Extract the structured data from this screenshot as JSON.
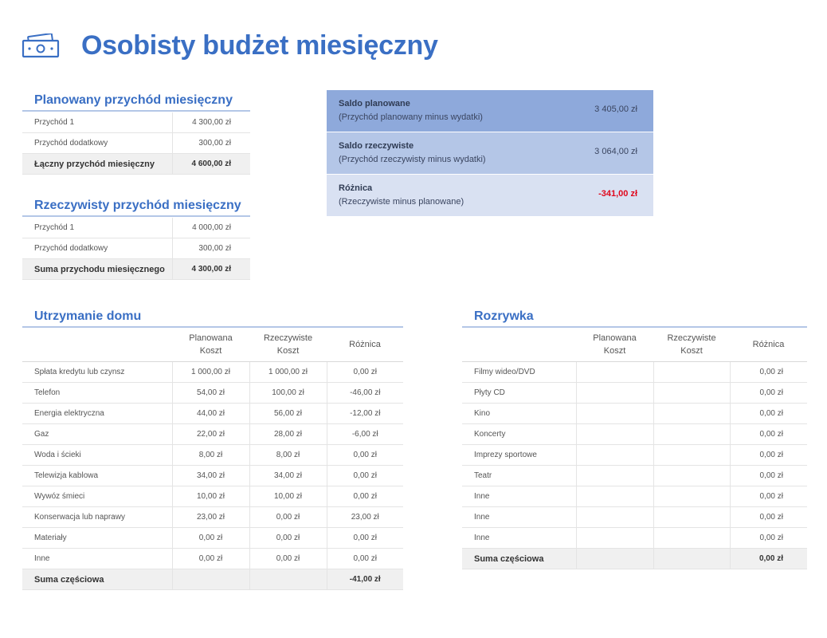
{
  "header": {
    "title": "Osobisty budżet miesięczny",
    "icon": "money-icon",
    "accent_color": "#3a6fc4"
  },
  "planned_income": {
    "title": "Planowany przychód miesięczny",
    "rows": [
      {
        "label": "Przychód 1",
        "value": "4 300,00 zł"
      },
      {
        "label": "Przychód dodatkowy",
        "value": "300,00 zł"
      }
    ],
    "total": {
      "label": "Łączny przychód miesięczny",
      "value": "4 600,00 zł"
    }
  },
  "actual_income": {
    "title": "Rzeczywisty przychód miesięczny",
    "rows": [
      {
        "label": "Przychód 1",
        "value": "4 000,00 zł"
      },
      {
        "label": "Przychód dodatkowy",
        "value": "300,00 zł"
      }
    ],
    "total": {
      "label": "Suma przychodu miesięcznego",
      "value": "4 300,00 zł"
    }
  },
  "saldo": {
    "rows": [
      {
        "title": "Saldo planowane",
        "subtitle": "(Przychód planowany minus wydatki)",
        "value": "3 405,00 zł",
        "bg": "#8ea9db"
      },
      {
        "title": "Saldo rzeczywiste",
        "subtitle": "(Przychód rzeczywisty minus wydatki)",
        "value": "3 064,00 zł",
        "bg": "#b4c6e7"
      },
      {
        "title": "Różnica",
        "subtitle": "(Rzeczywiste minus planowane)",
        "value": "-341,00 zł",
        "bg": "#d9e1f2"
      }
    ],
    "negative_color": "#e0061b"
  },
  "home": {
    "title": "Utrzymanie domu",
    "columns": {
      "planned": [
        "Planowana",
        "Koszt"
      ],
      "actual": [
        "Rzeczywiste",
        "Koszt"
      ],
      "diff": "Różnica"
    },
    "rows": [
      {
        "label": "Spłata kredytu lub czynsz",
        "planned": "1 000,00 zł",
        "actual": "1 000,00 zł",
        "diff": "0,00 zł"
      },
      {
        "label": "Telefon",
        "planned": "54,00 zł",
        "actual": "100,00 zł",
        "diff": "-46,00 zł"
      },
      {
        "label": "Energia elektryczna",
        "planned": "44,00 zł",
        "actual": "56,00 zł",
        "diff": "-12,00 zł"
      },
      {
        "label": "Gaz",
        "planned": "22,00 zł",
        "actual": "28,00 zł",
        "diff": "-6,00 zł"
      },
      {
        "label": "Woda i ścieki",
        "planned": "8,00 zł",
        "actual": "8,00 zł",
        "diff": "0,00 zł"
      },
      {
        "label": "Telewizja kablowa",
        "planned": "34,00 zł",
        "actual": "34,00 zł",
        "diff": "0,00 zł"
      },
      {
        "label": "Wywóz śmieci",
        "planned": "10,00 zł",
        "actual": "10,00 zł",
        "diff": "0,00 zł"
      },
      {
        "label": "Konserwacja lub naprawy",
        "planned": "23,00 zł",
        "actual": "0,00 zł",
        "diff": "23,00 zł"
      },
      {
        "label": "Materiały",
        "planned": "0,00 zł",
        "actual": "0,00 zł",
        "diff": "0,00 zł"
      },
      {
        "label": "Inne",
        "planned": "0,00 zł",
        "actual": "0,00 zł",
        "diff": "0,00 zł"
      }
    ],
    "subtotal": {
      "label": "Suma częściowa",
      "planned": "",
      "actual": "",
      "diff": "-41,00 zł"
    }
  },
  "entertainment": {
    "title": "Rozrywka",
    "columns": {
      "planned": [
        "Planowana",
        "Koszt"
      ],
      "actual": [
        "Rzeczywiste",
        "Koszt"
      ],
      "diff": "Różnica"
    },
    "rows": [
      {
        "label": "Filmy wideo/DVD",
        "planned": "",
        "actual": "",
        "diff": "0,00 zł"
      },
      {
        "label": "Płyty CD",
        "planned": "",
        "actual": "",
        "diff": "0,00 zł"
      },
      {
        "label": "Kino",
        "planned": "",
        "actual": "",
        "diff": "0,00 zł"
      },
      {
        "label": "Koncerty",
        "planned": "",
        "actual": "",
        "diff": "0,00 zł"
      },
      {
        "label": "Imprezy sportowe",
        "planned": "",
        "actual": "",
        "diff": "0,00 zł"
      },
      {
        "label": "Teatr",
        "planned": "",
        "actual": "",
        "diff": "0,00 zł"
      },
      {
        "label": "Inne",
        "planned": "",
        "actual": "",
        "diff": "0,00 zł"
      },
      {
        "label": "Inne",
        "planned": "",
        "actual": "",
        "diff": "0,00 zł"
      },
      {
        "label": "Inne",
        "planned": "",
        "actual": "",
        "diff": "0,00 zł"
      }
    ],
    "subtotal": {
      "label": "Suma częściowa",
      "planned": "",
      "actual": "",
      "diff": "0,00 zł"
    }
  }
}
